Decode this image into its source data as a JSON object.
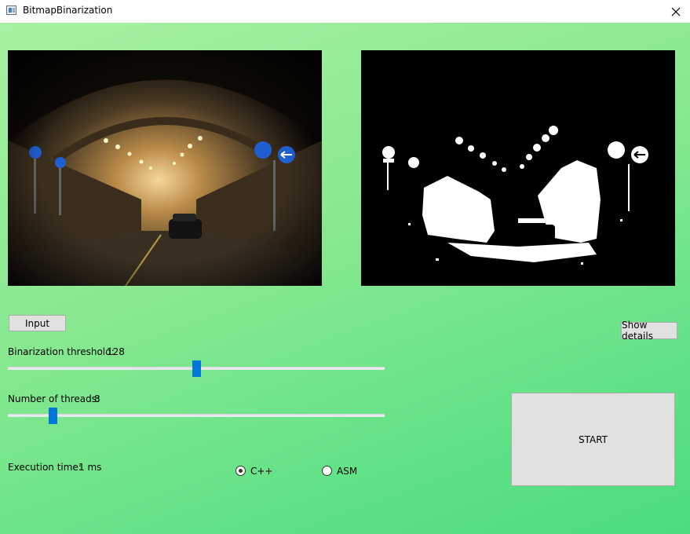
{
  "window": {
    "title": "BitmapBinarization"
  },
  "icons": {
    "app": "app-window-icon",
    "close": "close-icon"
  },
  "images": {
    "input": "tunnel-color-photo",
    "output": "tunnel-binarized-photo"
  },
  "buttons": {
    "input": "Input",
    "details": "Show details",
    "start": "START"
  },
  "threshold": {
    "label": "Binarization threshold:",
    "value": "128",
    "min": 0,
    "max": 255,
    "current": 128
  },
  "threads": {
    "label": "Number of threads:",
    "value": "8",
    "min": 1,
    "max": 64,
    "current": 8
  },
  "execution": {
    "label": "Execution time:",
    "value": "1 ms"
  },
  "mode": {
    "cpp": "C++",
    "asm": "ASM",
    "selected": "cpp"
  },
  "colors": {
    "accent": "#0078d7",
    "bg_light": "#a6f0a2",
    "bg_dark": "#4cdc7d"
  }
}
